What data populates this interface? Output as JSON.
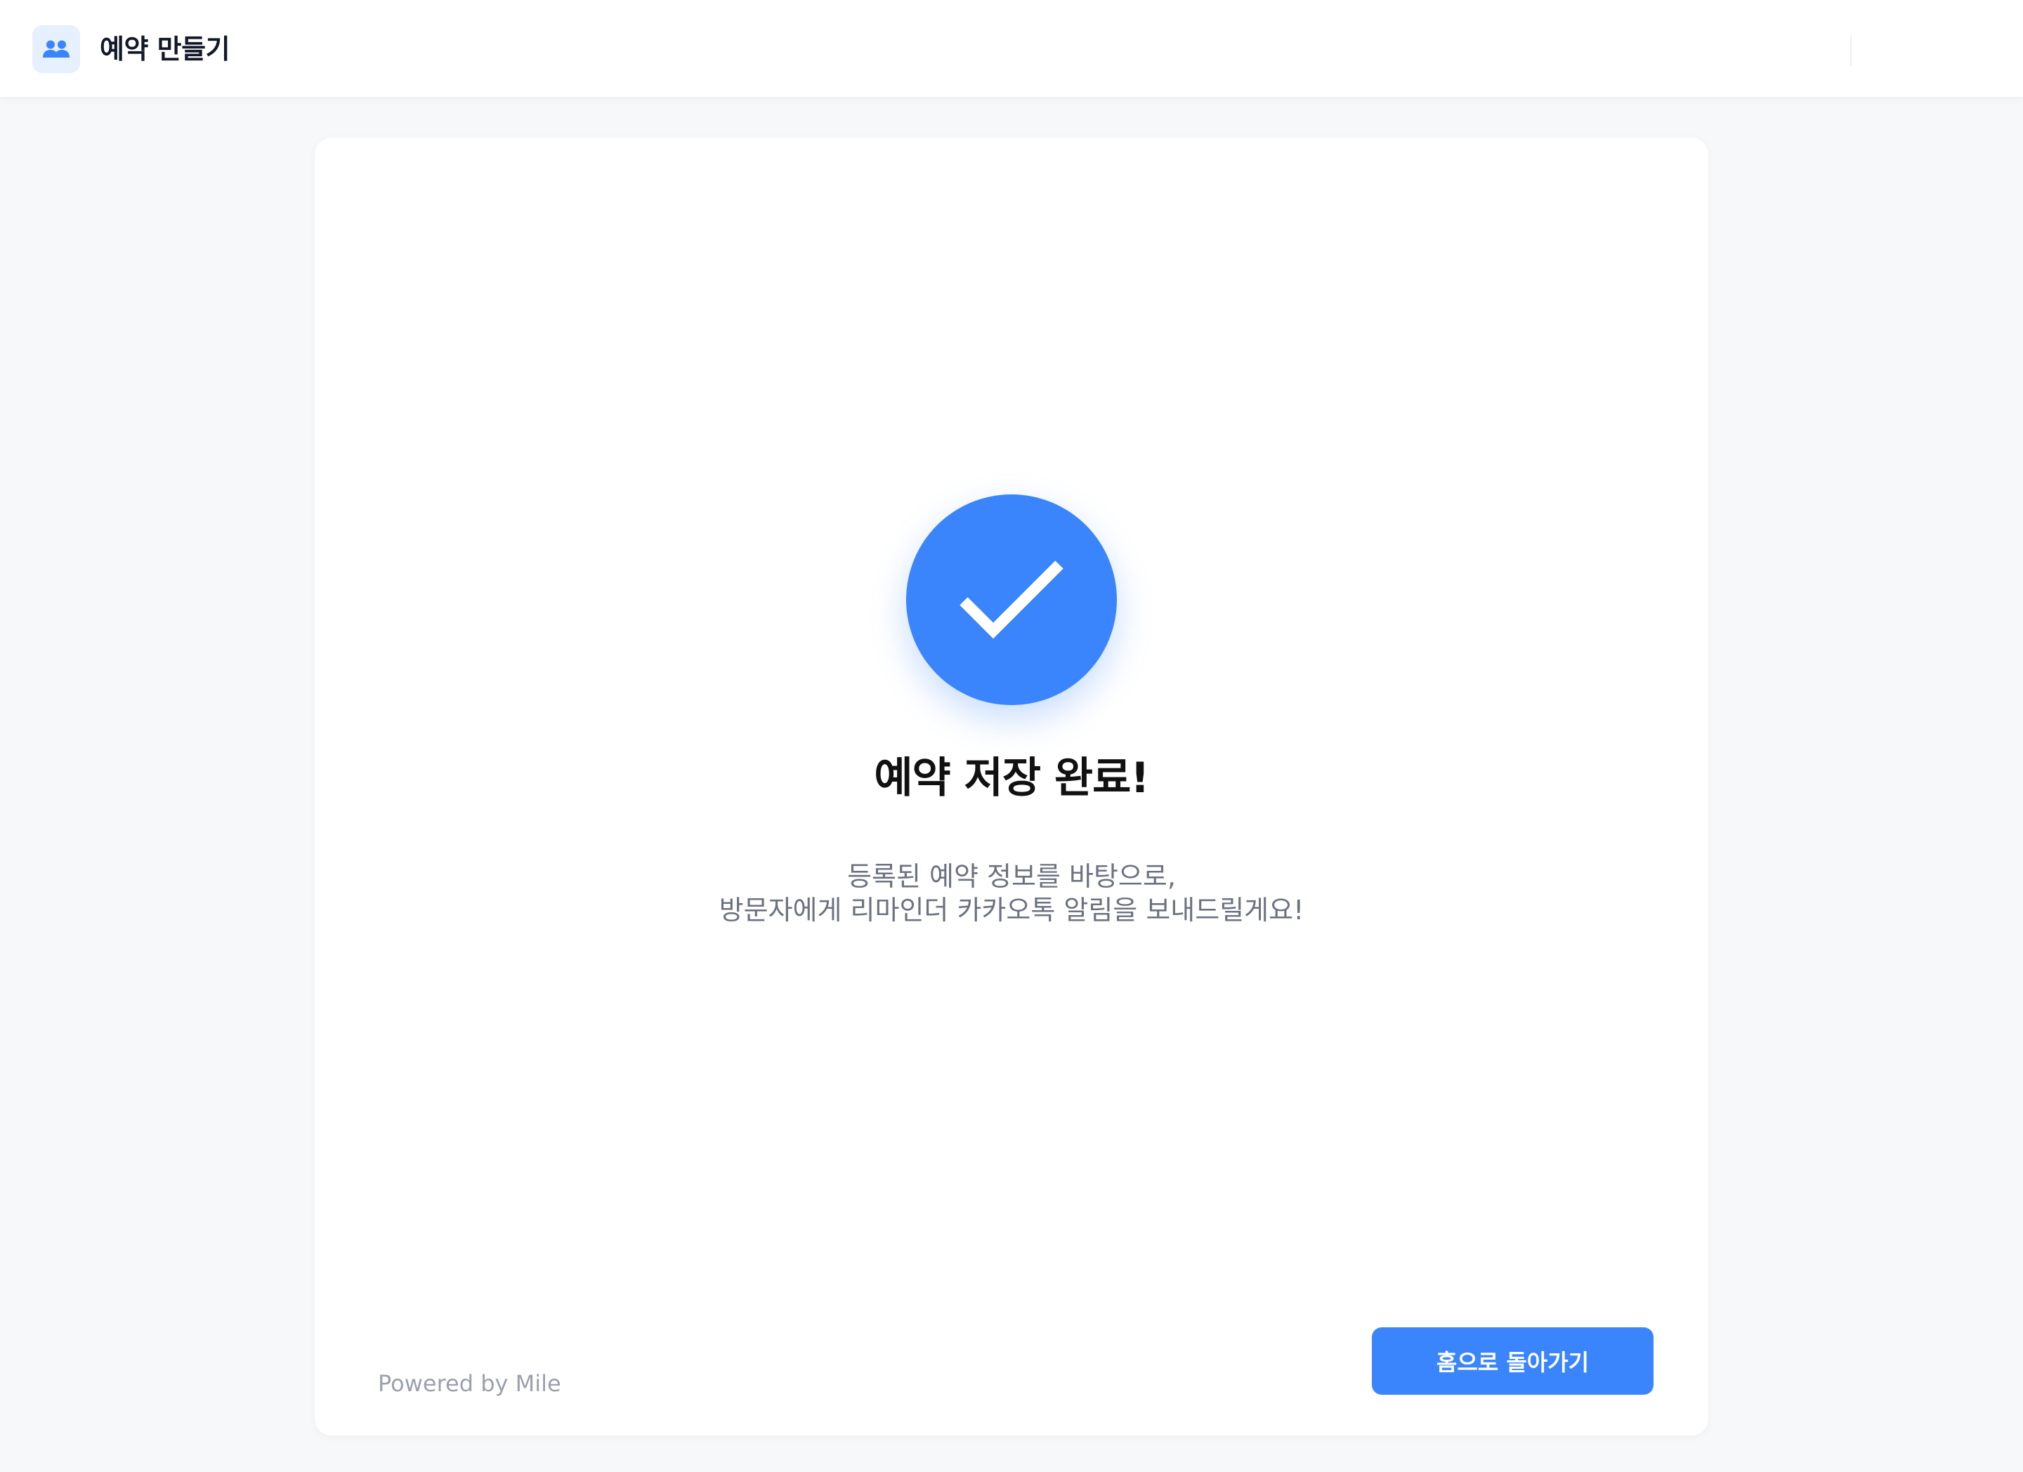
{
  "header": {
    "app_icon": "users-icon",
    "title": "예약 만들기"
  },
  "success": {
    "icon": "check-icon",
    "title": "예약 저장 완료!",
    "description_line1": "등록된 예약 정보를 바탕으로,",
    "description_line2": "방문자에게 리마인더 카카오톡 알림을 보내드릴게요!"
  },
  "footer": {
    "powered_by": "Powered by Mile",
    "home_button_label": "홈으로 돌아가기"
  },
  "colors": {
    "accent": "#3a84fc",
    "background": "#f7f8fa",
    "icon_bg": "#e6f0ff"
  }
}
